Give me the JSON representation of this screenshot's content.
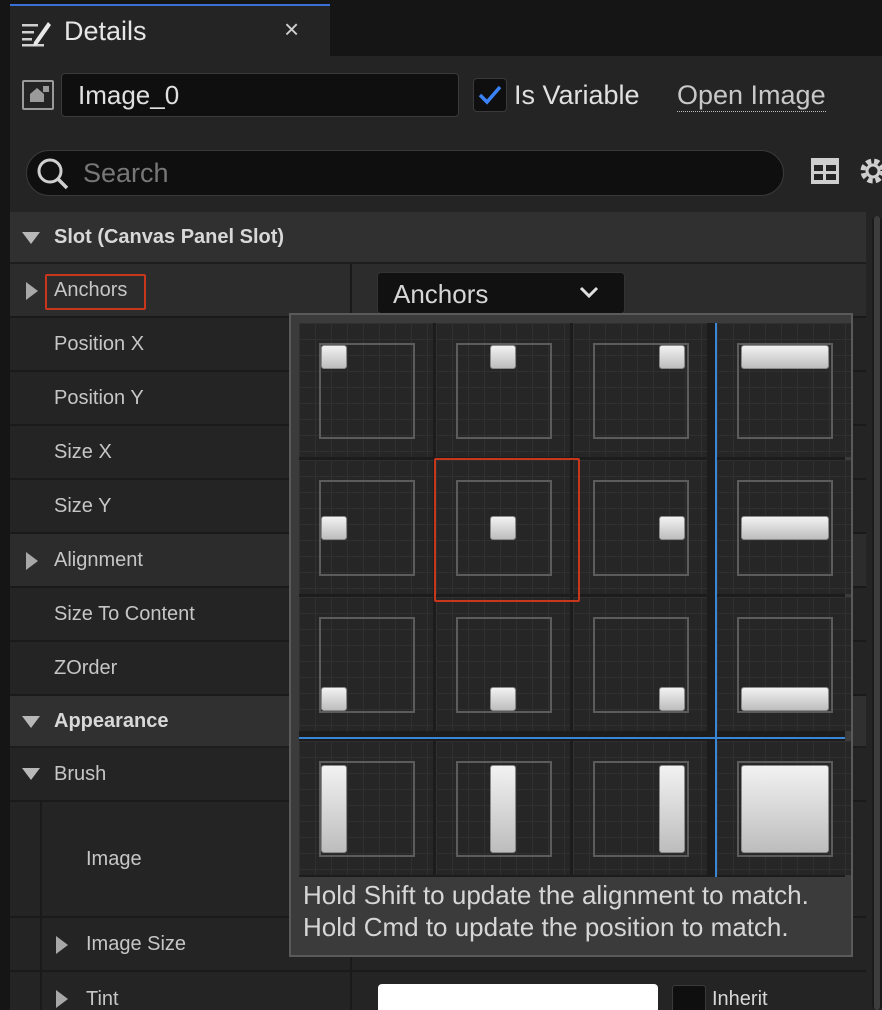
{
  "tab": {
    "title": "Details",
    "close_glyph": "×"
  },
  "header": {
    "name_value": "Image_0",
    "is_variable_label": "Is Variable",
    "is_variable_checked": true,
    "open_image_label": "Open Image"
  },
  "search": {
    "placeholder": "Search"
  },
  "sections": {
    "slot": "Slot (Canvas Panel Slot)",
    "appearance": "Appearance",
    "brush": "Brush"
  },
  "slot_props": {
    "anchors": "Anchors",
    "position_x": "Position X",
    "position_y": "Position Y",
    "size_x": "Size X",
    "size_y": "Size Y",
    "alignment": "Alignment",
    "size_to_content": "Size To Content",
    "zorder": "ZOrder"
  },
  "anchors_dropdown": {
    "value": "Anchors"
  },
  "brush_props": {
    "image": "Image",
    "image_size": "Image Size",
    "tint": "Tint",
    "inherit": "Inherit"
  },
  "popup": {
    "line1": "Hold Shift to update the alignment to match.",
    "line2": "Hold Cmd to update the position to match."
  },
  "colors": {
    "highlight": "#c8361c",
    "accent_blue": "#3a86d6",
    "checkbox_blue": "#3b82f6"
  }
}
